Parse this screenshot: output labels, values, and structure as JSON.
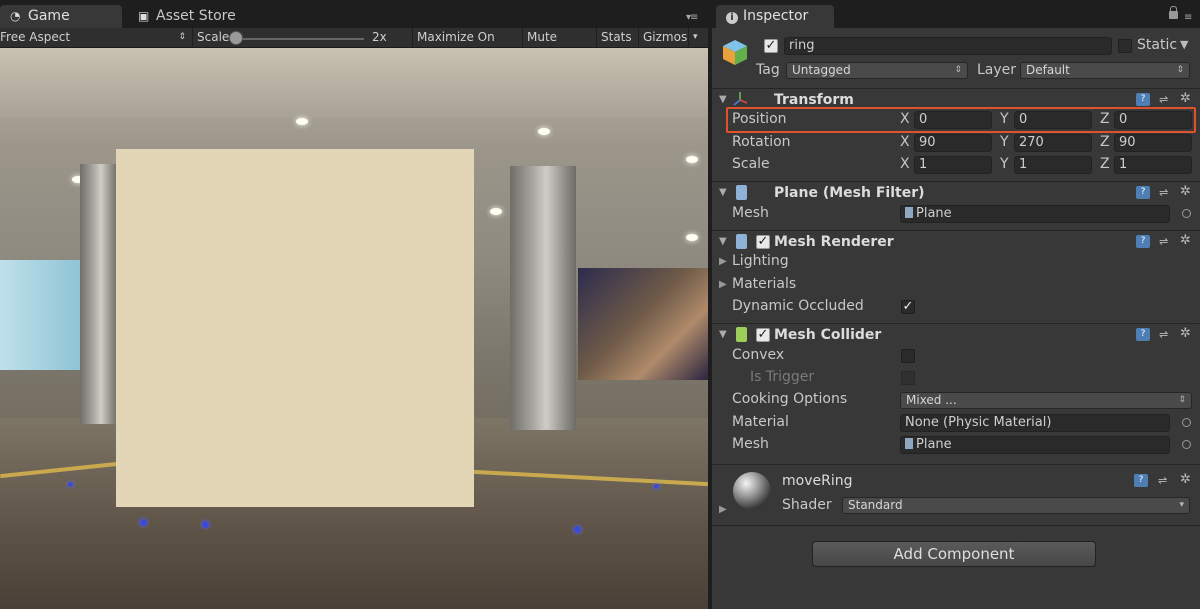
{
  "game": {
    "tabs": [
      {
        "label": "Game",
        "icon": "pacman-icon"
      },
      {
        "label": "Asset Store",
        "icon": "shopping-bag-icon"
      }
    ],
    "toolbar": {
      "aspect": "Free Aspect",
      "scale_label": "Scale",
      "scale_value": "2x",
      "maximize_on_play": "Maximize On Play",
      "mute_audio": "Mute Audio",
      "stats": "Stats",
      "gizmos": "Gizmos"
    }
  },
  "inspector": {
    "tab_label": "Inspector",
    "object": {
      "name": "ring",
      "active": true,
      "static_label": "Static",
      "static_checked": false,
      "tag_label": "Tag",
      "tag_value": "Untagged",
      "layer_label": "Layer",
      "layer_value": "Default"
    },
    "transform": {
      "title": "Transform",
      "position_label": "Position",
      "rotation_label": "Rotation",
      "scale_label": "Scale",
      "axes": [
        "X",
        "Y",
        "Z"
      ],
      "position": [
        "0",
        "0",
        "0"
      ],
      "rotation": [
        "90",
        "270",
        "90"
      ],
      "scale": [
        "1",
        "1",
        "1"
      ]
    },
    "mesh_filter": {
      "title": "Plane (Mesh Filter)",
      "mesh_label": "Mesh",
      "mesh_value": "Plane"
    },
    "mesh_renderer": {
      "title": "Mesh Renderer",
      "enabled": true,
      "lighting_label": "Lighting",
      "materials_label": "Materials",
      "dynamic_occluded_label": "Dynamic Occluded",
      "dynamic_occluded": true
    },
    "mesh_collider": {
      "title": "Mesh Collider",
      "enabled": true,
      "convex_label": "Convex",
      "is_trigger_label": "Is Trigger",
      "cooking_options_label": "Cooking Options",
      "cooking_options_value": "Mixed ...",
      "material_label": "Material",
      "material_value": "None (Physic Material)",
      "mesh_label": "Mesh",
      "mesh_value": "Plane"
    },
    "material": {
      "name": "moveRing",
      "shader_label": "Shader",
      "shader_value": "Standard"
    },
    "add_component_label": "Add Component"
  },
  "colors": {
    "highlight": "#e0522e",
    "help_icon": "#4d7fb5"
  }
}
